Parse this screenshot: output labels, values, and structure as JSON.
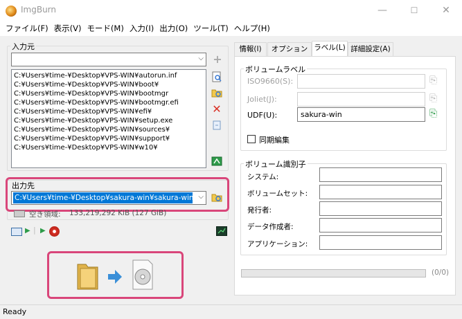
{
  "window": {
    "title": "ImgBurn",
    "minimize": "—",
    "maximize": "☐",
    "close": "✕"
  },
  "menu": [
    "ファイル(F)",
    "表示(V)",
    "モード(M)",
    "入力(I)",
    "出力(O)",
    "ツール(T)",
    "ヘルプ(H)"
  ],
  "source": {
    "group_title": "入力元",
    "combo_value": "",
    "files": [
      "C:¥Users¥time-¥Desktop¥VPS-WIN¥autorun.inf",
      "C:¥Users¥time-¥Desktop¥VPS-WIN¥boot¥",
      "C:¥Users¥time-¥Desktop¥VPS-WIN¥bootmgr",
      "C:¥Users¥time-¥Desktop¥VPS-WIN¥bootmgr.efi",
      "C:¥Users¥time-¥Desktop¥VPS-WIN¥efi¥",
      "C:¥Users¥time-¥Desktop¥VPS-WIN¥setup.exe",
      "C:¥Users¥time-¥Desktop¥VPS-WIN¥sources¥",
      "C:¥Users¥time-¥Desktop¥VPS-WIN¥support¥",
      "C:¥Users¥time-¥Desktop¥VPS-WIN¥w10¥"
    ]
  },
  "destination": {
    "group_title": "出力先",
    "path": "C:¥Users¥time-¥Desktop¥sakura-win¥sakura-win.iso",
    "free_space_label": "空き領域:",
    "free_space_value": "133,219,292 KiB  (127 GiB)"
  },
  "tabs": [
    "情報(I)",
    "オプション(P)",
    "ラベル(L)",
    "詳細設定(A)"
  ],
  "active_tab": "ラベル(L)",
  "volume_label": {
    "group_title": "ボリュームラベル",
    "iso9660_label": "ISO9660(S):",
    "iso9660_value": "",
    "joliet_label": "Joliet(J):",
    "joliet_value": "",
    "udf_label": "UDF(U):",
    "udf_value": "sakura-win",
    "sync_label": "同期編集",
    "sync_checked": false
  },
  "volume_id": {
    "group_title": "ボリューム識別子",
    "fields": [
      {
        "label": "システム:",
        "value": ""
      },
      {
        "label": "ボリュームセット:",
        "value": ""
      },
      {
        "label": "発行者:",
        "value": ""
      },
      {
        "label": "データ作成者:",
        "value": ""
      },
      {
        "label": "アプリケーション:",
        "value": ""
      }
    ]
  },
  "progress": {
    "text": "(0/0)",
    "fraction": 0
  },
  "status": {
    "text": "Ready"
  },
  "colors": {
    "highlight": "#d9467a",
    "selection": "#0078d7"
  }
}
